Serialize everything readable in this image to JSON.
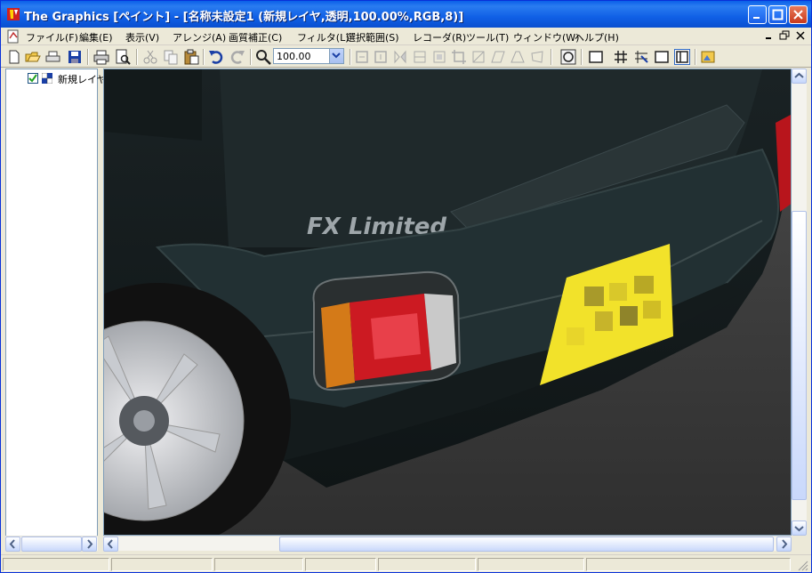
{
  "window": {
    "title": "The Graphics [ペイント] - [名称未設定1 (新規レイヤ,透明,100.00%,RGB,8)]"
  },
  "menu": {
    "items": [
      "ファイル(F)",
      "編集(E)",
      "表示(V)",
      "アレンジ(A)",
      "画質補正(C)",
      "フィルタ(L)",
      "選択範囲(S)",
      "レコーダ(R)",
      "ツール(T)",
      "ウィンドウ(W)",
      "ヘルプ(H)"
    ]
  },
  "toolbar": {
    "zoom_value": "100.00"
  },
  "tree": {
    "layer_name": "新規レイヤ"
  },
  "image": {
    "badge_text": "FX Limited"
  },
  "colors": {
    "title_blue": "#0a5fe8",
    "chrome": "#ece9d8",
    "taillight_red": "#cc1a22",
    "plate_yellow": "#f2e22a"
  }
}
